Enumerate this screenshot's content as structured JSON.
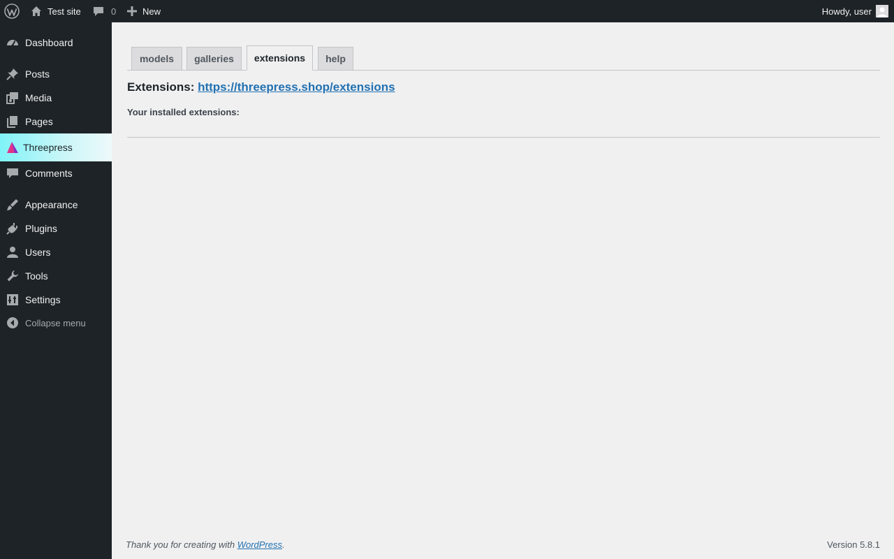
{
  "adminbar": {
    "site_name": "Test site",
    "comments_count": "0",
    "new_label": "New",
    "greeting": "Howdy, user",
    "icons": [
      "wordpress-logo-icon",
      "home-icon",
      "comment-icon",
      "plus-icon",
      "user-avatar-icon"
    ]
  },
  "sidebar": {
    "items": [
      {
        "label": "Dashboard",
        "icon": "dashboard-icon"
      },
      {
        "label": "Posts",
        "icon": "pushpin-icon"
      },
      {
        "label": "Media",
        "icon": "media-icon"
      },
      {
        "label": "Pages",
        "icon": "pages-icon"
      },
      {
        "label": "Threepress",
        "icon": "threepress-logo-icon",
        "current": true
      },
      {
        "label": "Comments",
        "icon": "comment-icon"
      },
      {
        "label": "Appearance",
        "icon": "paintbrush-icon"
      },
      {
        "label": "Plugins",
        "icon": "plugin-icon"
      },
      {
        "label": "Users",
        "icon": "user-icon"
      },
      {
        "label": "Tools",
        "icon": "wrench-icon"
      },
      {
        "label": "Settings",
        "icon": "settings-icon"
      }
    ],
    "collapse_label": "Collapse menu"
  },
  "tabs": [
    {
      "label": "models"
    },
    {
      "label": "galleries"
    },
    {
      "label": "extensions",
      "active": true
    },
    {
      "label": "help"
    }
  ],
  "main": {
    "heading_prefix": "Extensions:",
    "heading_link": "https://threepress.shop/extensions",
    "installed_label": "Your installed extensions:"
  },
  "footer": {
    "thanks_prefix": "Thank you for creating with",
    "thanks_link": "WordPress",
    "thanks_suffix": ".",
    "version": "Version 5.8.1"
  },
  "colors": {
    "admin_bg": "#1d2327",
    "content_bg": "#f0f0f1",
    "link": "#2271b1",
    "current_menu_gradient_start": "#7ff3f7"
  }
}
